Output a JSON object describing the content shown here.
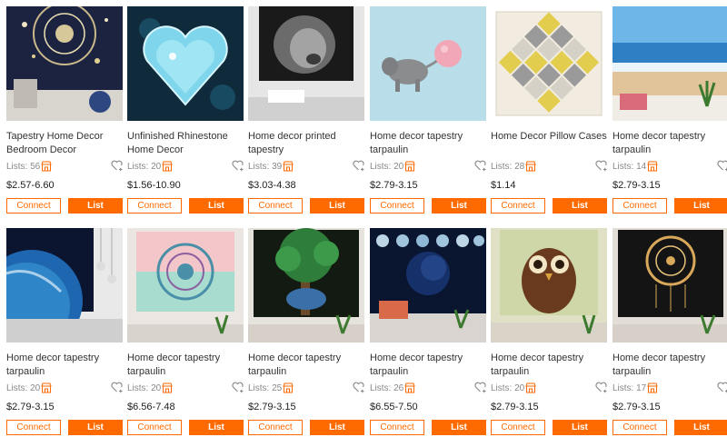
{
  "accent_color": "#ff6a00",
  "buttons": {
    "connect": "Connect",
    "list": "List"
  },
  "products": [
    {
      "title": "Tapestry Home Decor Bedroom Decor Backgrou...",
      "lists": "Lists: 56",
      "price": "$2.57-6.60",
      "image": "mandala-night-tapestry"
    },
    {
      "title": "Unfinished Rhinestone Home Decor",
      "lists": "Lists: 20",
      "price": "$1.56-10.90",
      "image": "crystal-heart"
    },
    {
      "title": "Home decor printed tapestry",
      "lists": "Lists: 39",
      "price": "$3.03-4.38",
      "image": "lion-tapestry"
    },
    {
      "title": "Home decor tapestry tarpaulin",
      "lists": "Lists: 20",
      "price": "$2.79-3.15",
      "image": "elephant-balloon"
    },
    {
      "title": "Home Decor Pillow Cases",
      "lists": "Lists: 28",
      "price": "$1.14",
      "image": "diamond-pillow"
    },
    {
      "title": "Home decor tapestry tarpaulin",
      "lists": "Lists: 14",
      "price": "$2.79-3.15",
      "image": "beach-tapestry"
    },
    {
      "title": "Home decor tapestry tarpaulin",
      "lists": "Lists: 20",
      "price": "$2.79-3.15",
      "image": "earth-space-tapestry"
    },
    {
      "title": "Home decor tapestry tarpaulin",
      "lists": "Lists: 20",
      "price": "$6.56-7.48",
      "image": "pastel-mandala-tapestry"
    },
    {
      "title": "Home decor tapestry tarpaulin",
      "lists": "Lists: 25",
      "price": "$2.79-3.15",
      "image": "tree-elephant-tapestry"
    },
    {
      "title": "Home decor tapestry tarpaulin",
      "lists": "Lists: 26",
      "price": "$6.55-7.50",
      "image": "moon-phases-tapestry"
    },
    {
      "title": "Home decor tapestry tarpaulin",
      "lists": "Lists: 20",
      "price": "$2.79-3.15",
      "image": "owl-tapestry"
    },
    {
      "title": "Home decor tapestry tarpaulin",
      "lists": "Lists: 17",
      "price": "$2.79-3.15",
      "image": "dreamcatcher-tapestry"
    }
  ]
}
